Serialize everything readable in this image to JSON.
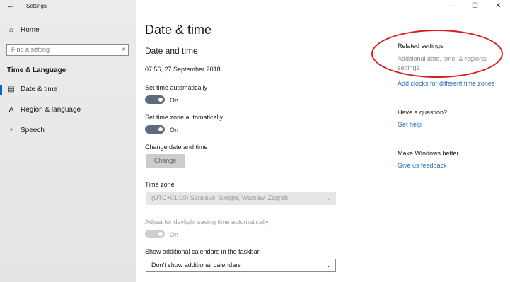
{
  "window": {
    "title": "Settings",
    "controls": [
      "—",
      "☐",
      "✕"
    ]
  },
  "sidebar": {
    "back_icon": "back-arrow-icon",
    "home_label": "Home",
    "search_placeholder": "Find a setting",
    "section_label": "Time & Language",
    "items": [
      {
        "label": "Date & time",
        "icon": "calendar-icon",
        "selected": true
      },
      {
        "label": "Region & language",
        "icon": "globe-icon",
        "selected": false
      },
      {
        "label": "Speech",
        "icon": "microphone-icon",
        "selected": false
      }
    ]
  },
  "main": {
    "page_title": "Date & time",
    "subtitle": "Date and time",
    "current_datetime": "07:56, 27 September 2018",
    "set_time_auto": {
      "label": "Set time automatically",
      "state": "On"
    },
    "set_timezone_auto": {
      "label": "Set time zone automatically",
      "state": "On"
    },
    "change_date": {
      "label": "Change date and time",
      "button": "Change"
    },
    "time_zone": {
      "label": "Time zone",
      "value": "(UTC+01:00) Sarajevo, Skopje, Warsaw, Zagreb"
    },
    "daylight": {
      "label": "Adjust for daylight saving time automatically",
      "state": "On"
    },
    "calendars": {
      "label": "Show additional calendars in the taskbar",
      "value": "Don't show additional calendars"
    }
  },
  "related": {
    "heading": "Related settings",
    "link1": "Additional date, time, & regional settings",
    "link2": "Add clocks for different time zones",
    "question_heading": "Have a question?",
    "question_link": "Get help",
    "feedback_heading": "Make Windows better",
    "feedback_link": "Give us feedback"
  },
  "colors": {
    "accent": "#0a64c8",
    "link": "#2c6fb5",
    "toggle_on": "#5c6c7c",
    "annotation": "#d91c1c"
  }
}
